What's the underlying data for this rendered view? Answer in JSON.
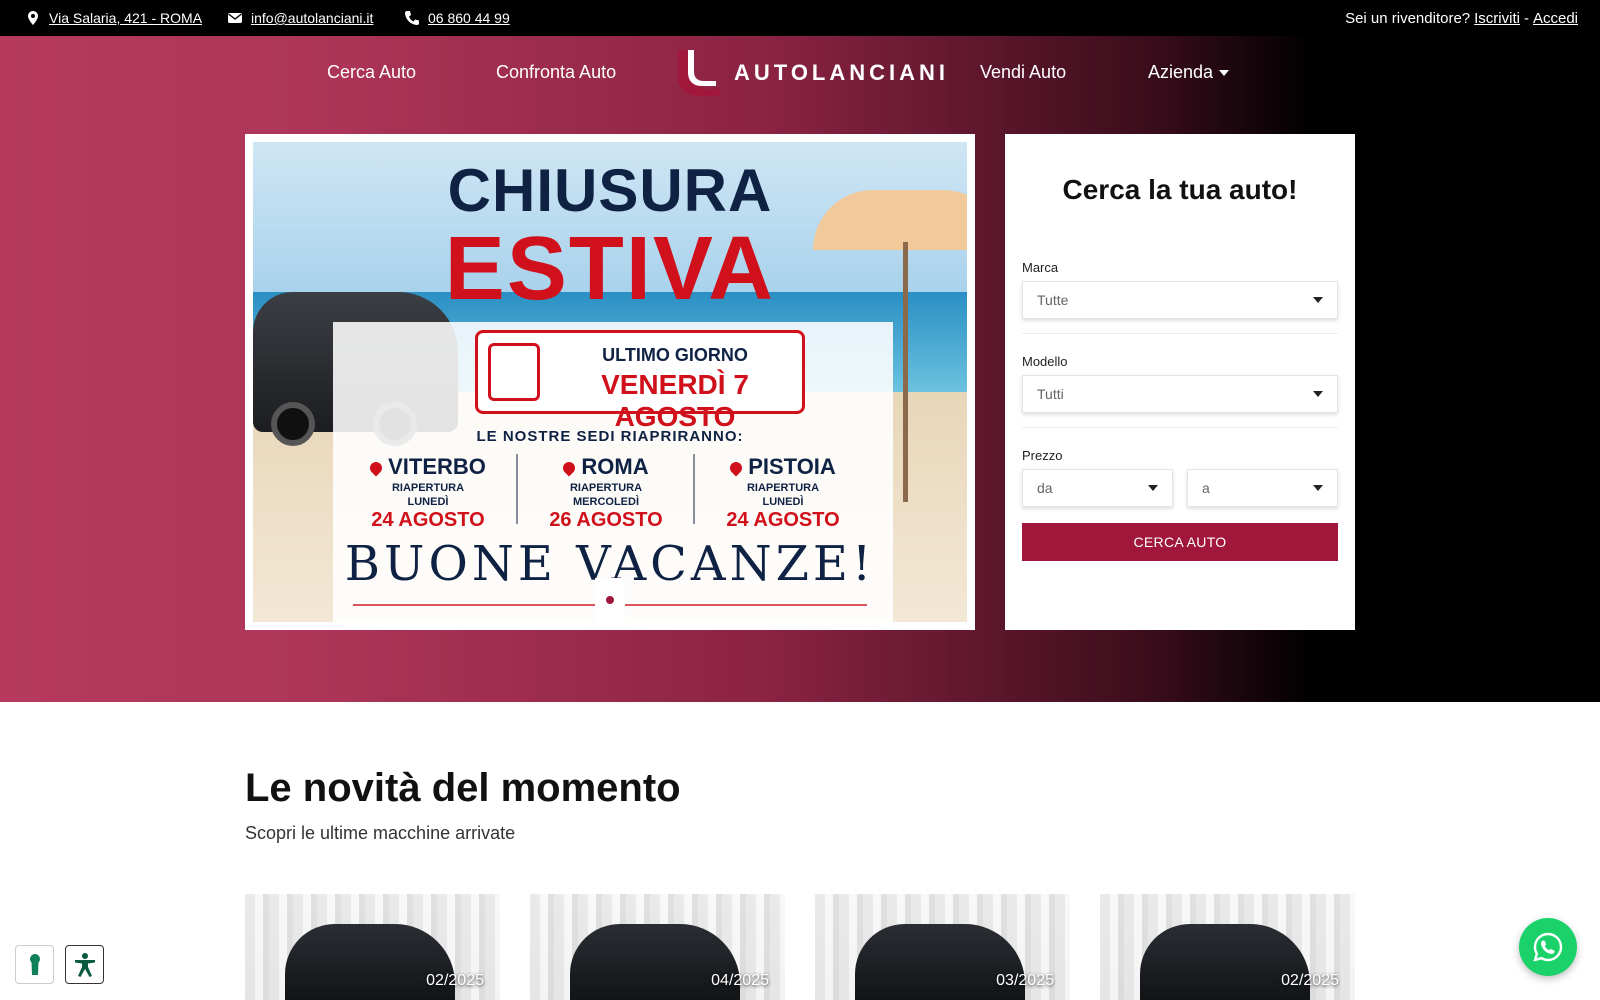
{
  "topbar": {
    "address": "Via Salaria, 421 - ROMA",
    "email": "info@autolanciani.it",
    "phone": "06 860 44 99",
    "reseller_question": "Sei un rivenditore?",
    "signup": "Iscriviti",
    "separator": "-",
    "login": "Accedi"
  },
  "nav": {
    "items": [
      "Cerca Auto",
      "Confronta Auto",
      "Vendi Auto",
      "Azienda"
    ],
    "brand": "AUTOLANCIANI"
  },
  "slider": {
    "headline_1": "CHIUSURA",
    "headline_2": "ESTIVA",
    "box_line_1": "ULTIMO GIORNO",
    "box_line_2": "VENERDÌ 7 AGOSTO",
    "subheading": "LE NOSTRE SEDI RIAPRIRANNO:",
    "locations": [
      {
        "city": "VITERBO",
        "label": "RIAPERTURA",
        "day": "LUNEDÌ",
        "date": "24 AGOSTO"
      },
      {
        "city": "ROMA",
        "label": "RIAPERTURA",
        "day": "MERCOLEDÌ",
        "date": "26 AGOSTO"
      },
      {
        "city": "PISTOIA",
        "label": "RIAPERTURA",
        "day": "LUNEDÌ",
        "date": "24 AGOSTO"
      }
    ],
    "footer": "BUONE VACANZE!",
    "active_slide": 1,
    "slide_count": 1
  },
  "search": {
    "title": "Cerca la tua auto!",
    "brand_label": "Marca",
    "brand_value": "Tutte",
    "model_label": "Modello",
    "model_value": "Tutti",
    "price_label": "Prezzo",
    "price_from": "da",
    "price_to": "a",
    "submit": "CERCA AUTO"
  },
  "news": {
    "title": "Le novità del momento",
    "subtitle": "Scopri le ultime macchine arrivate",
    "cards": [
      {
        "date": "02/2025"
      },
      {
        "date": "04/2025"
      },
      {
        "date": "03/2025"
      },
      {
        "date": "02/2025"
      }
    ]
  },
  "colors": {
    "accent": "#a0173b",
    "hero_left": "#b73a5e",
    "topbar": "#000000",
    "whatsapp": "#1bd26a"
  },
  "icons": [
    "map-pin-icon",
    "envelope-icon",
    "phone-icon",
    "caret-down-icon",
    "calendar-icon",
    "whatsapp-icon",
    "keyhole-icon",
    "accessibility-icon"
  ]
}
